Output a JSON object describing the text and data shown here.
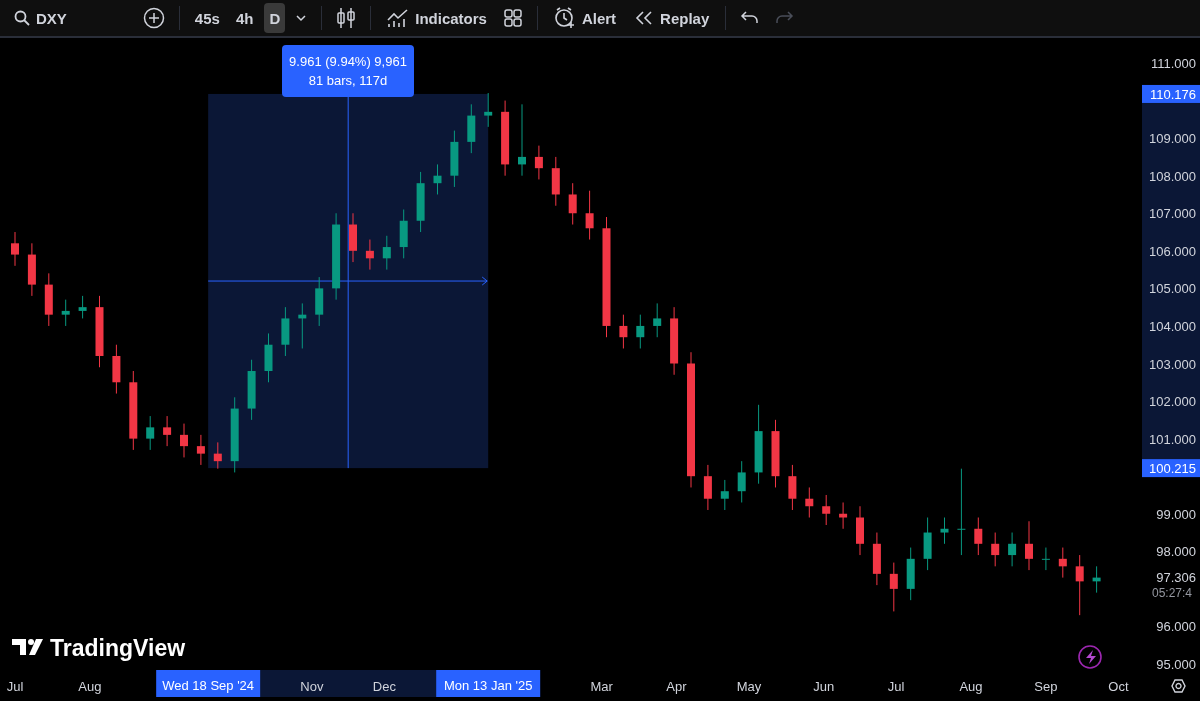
{
  "toolbar": {
    "symbol": "DXY",
    "intervals": [
      {
        "label": "45s",
        "selected": false
      },
      {
        "label": "4h",
        "selected": false
      },
      {
        "label": "D",
        "selected": true
      }
    ],
    "buttons": [
      {
        "kind": "indicators",
        "label": "Indicators"
      },
      {
        "kind": "alert",
        "label": "Alert"
      },
      {
        "kind": "replay",
        "label": "Replay"
      }
    ],
    "redo_disabled": true
  },
  "chart": {
    "chart_data": {
      "type": "candlestick",
      "categories": [
        null,
        null,
        null,
        null,
        null,
        null,
        null,
        null,
        null,
        null,
        null,
        null,
        null,
        null,
        null,
        null,
        null,
        null,
        null,
        null,
        null,
        null,
        null,
        null,
        null,
        null,
        null,
        null,
        null,
        null,
        null,
        null,
        null,
        null,
        null,
        null,
        null,
        null,
        null,
        null,
        null,
        null,
        null,
        null,
        null,
        null,
        null,
        null,
        null,
        null,
        null,
        null,
        null,
        null,
        null,
        null,
        null,
        null,
        null,
        null,
        null,
        null,
        null,
        null,
        null
      ],
      "ohlc": [
        [
          106.2,
          106.5,
          105.6,
          105.9
        ],
        [
          105.9,
          106.2,
          104.8,
          105.1
        ],
        [
          105.1,
          105.4,
          104.0,
          104.3
        ],
        [
          104.3,
          104.7,
          104.0,
          104.4
        ],
        [
          104.4,
          104.8,
          104.2,
          104.5
        ],
        [
          104.5,
          104.8,
          102.9,
          103.2
        ],
        [
          103.2,
          103.5,
          102.2,
          102.5
        ],
        [
          102.5,
          102.8,
          100.7,
          101.0
        ],
        [
          101.0,
          101.6,
          100.7,
          101.3
        ],
        [
          101.3,
          101.6,
          100.8,
          101.1
        ],
        [
          101.1,
          101.4,
          100.5,
          100.8
        ],
        [
          100.8,
          101.1,
          100.3,
          100.6
        ],
        [
          100.6,
          100.9,
          100.2,
          100.4
        ],
        [
          100.4,
          102.1,
          100.1,
          101.8
        ],
        [
          101.8,
          103.1,
          101.5,
          102.8
        ],
        [
          102.8,
          103.8,
          102.5,
          103.5
        ],
        [
          103.5,
          104.5,
          103.2,
          104.2
        ],
        [
          104.2,
          104.6,
          103.4,
          104.3
        ],
        [
          104.3,
          105.3,
          104.0,
          105.0
        ],
        [
          105.0,
          107.0,
          104.7,
          106.7
        ],
        [
          106.7,
          107.0,
          105.7,
          106.0
        ],
        [
          106.0,
          106.3,
          105.5,
          105.8
        ],
        [
          105.8,
          106.4,
          105.5,
          106.1
        ],
        [
          106.1,
          107.1,
          105.8,
          106.8
        ],
        [
          106.8,
          108.1,
          106.5,
          107.8
        ],
        [
          107.8,
          108.3,
          107.5,
          108.0
        ],
        [
          108.0,
          109.2,
          107.7,
          108.9
        ],
        [
          108.9,
          109.9,
          108.6,
          109.6
        ],
        [
          109.6,
          110.2,
          109.3,
          109.7
        ],
        [
          109.7,
          110.0,
          108.0,
          108.3
        ],
        [
          108.3,
          109.9,
          108.0,
          108.5
        ],
        [
          108.5,
          108.8,
          107.9,
          108.2
        ],
        [
          108.2,
          108.5,
          107.2,
          107.5
        ],
        [
          107.5,
          107.8,
          106.7,
          107.0
        ],
        [
          107.0,
          107.6,
          106.3,
          106.6
        ],
        [
          106.6,
          106.9,
          103.7,
          104.0
        ],
        [
          104.0,
          104.3,
          103.4,
          103.7
        ],
        [
          103.7,
          104.3,
          103.4,
          104.0
        ],
        [
          104.0,
          104.6,
          103.7,
          104.2
        ],
        [
          104.2,
          104.5,
          102.7,
          103.0
        ],
        [
          103.0,
          103.3,
          99.7,
          100.0
        ],
        [
          100.0,
          100.3,
          99.1,
          99.4
        ],
        [
          99.4,
          99.9,
          99.1,
          99.6
        ],
        [
          99.6,
          100.4,
          99.3,
          100.1
        ],
        [
          100.1,
          101.9,
          99.8,
          101.2
        ],
        [
          101.2,
          101.5,
          99.7,
          100.0
        ],
        [
          100.0,
          100.3,
          99.1,
          99.4
        ],
        [
          99.4,
          99.7,
          98.9,
          99.2
        ],
        [
          99.2,
          99.5,
          98.7,
          99.0
        ],
        [
          99.0,
          99.3,
          98.6,
          98.9
        ],
        [
          98.9,
          99.2,
          97.9,
          98.2
        ],
        [
          98.2,
          98.5,
          97.1,
          97.4
        ],
        [
          97.4,
          97.7,
          96.4,
          97.0
        ],
        [
          97.0,
          98.1,
          96.7,
          97.8
        ],
        [
          97.8,
          98.9,
          97.5,
          98.5
        ],
        [
          98.5,
          98.9,
          98.2,
          98.6
        ],
        [
          98.6,
          100.2,
          97.9,
          98.6
        ],
        [
          98.6,
          98.9,
          97.9,
          98.2
        ],
        [
          98.2,
          98.5,
          97.6,
          97.9
        ],
        [
          97.9,
          98.5,
          97.6,
          98.2
        ],
        [
          98.2,
          98.8,
          97.5,
          97.8
        ],
        [
          97.8,
          98.1,
          97.5,
          97.8
        ],
        [
          97.8,
          98.1,
          97.3,
          97.6
        ],
        [
          97.6,
          97.9,
          96.3,
          97.2
        ],
        [
          97.2,
          97.6,
          96.9,
          97.3
        ]
      ],
      "yticks": [
        {
          "value": 111,
          "label": "111.000"
        },
        {
          "value": 109,
          "label": "109.000"
        },
        {
          "value": 108,
          "label": "108.000"
        },
        {
          "value": 107,
          "label": "107.000"
        },
        {
          "value": 106,
          "label": "106.000"
        },
        {
          "value": 105,
          "label": "105.000"
        },
        {
          "value": 104,
          "label": "104.000"
        },
        {
          "value": 103,
          "label": "103.000"
        },
        {
          "value": 102,
          "label": "102.000"
        },
        {
          "value": 101,
          "label": "101.000"
        },
        {
          "value": 99,
          "label": "99.000"
        },
        {
          "value": 98,
          "label": "98.000"
        },
        {
          "value": 96,
          "label": "96.000"
        },
        {
          "value": 95,
          "label": "95.000"
        }
      ],
      "ylim": [
        95,
        111
      ]
    },
    "time_axis": [
      "Jul",
      "Aug",
      "Nov",
      "Dec",
      "Mar",
      "Apr",
      "May",
      "Jun",
      "Jul",
      "Aug",
      "Sep",
      "Oct"
    ],
    "measure": {
      "tooltip": [
        "9.961 (9.94%) 9,961",
        "81 bars, 117d"
      ],
      "start_label": "Wed 18 Sep '24",
      "end_label": "Mon 13 Jan '25",
      "high_label": "110.176",
      "low_label": "100.215"
    },
    "last_price": {
      "label": "97.306",
      "countdown": "05:27:4"
    },
    "logo": "TradingView"
  }
}
